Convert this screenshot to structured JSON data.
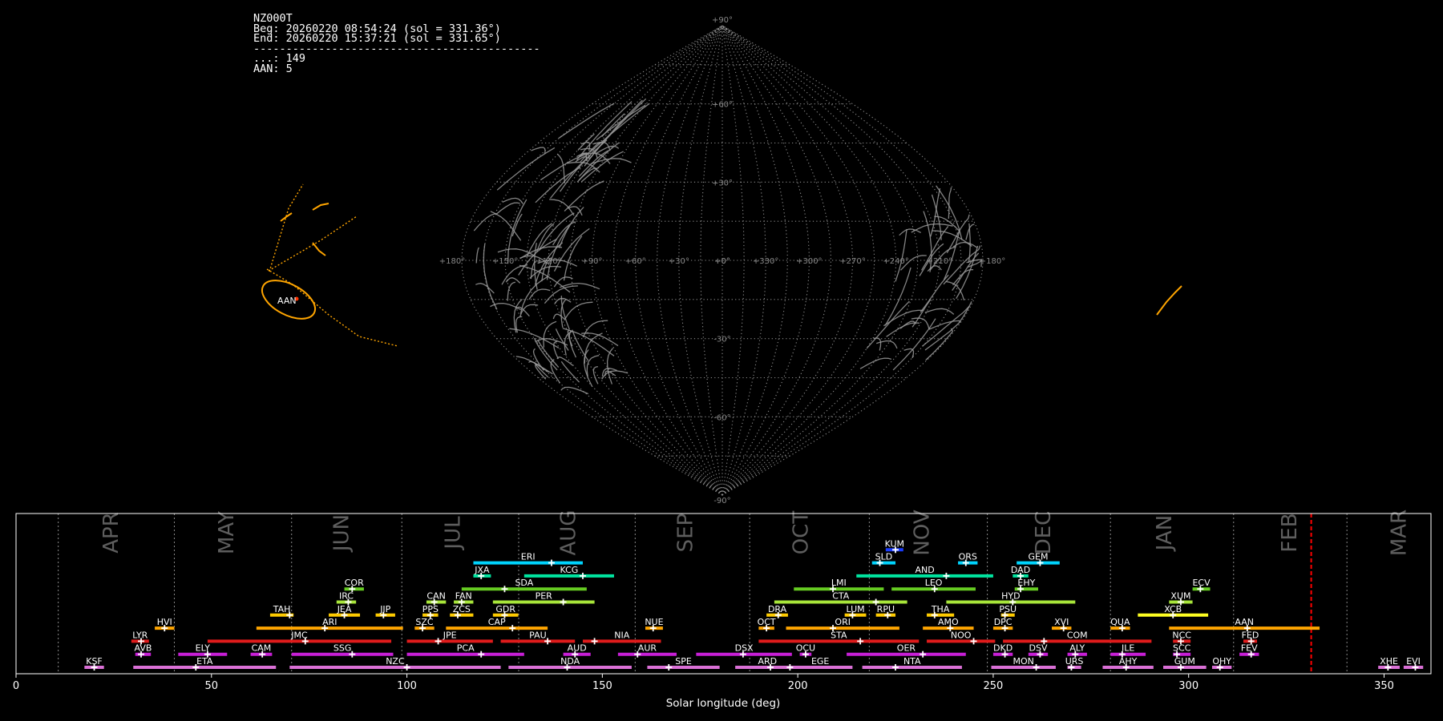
{
  "info": {
    "station": "NZ000T",
    "begin": "Beg: 20260220 08:54:24 (sol = 331.36°)",
    "end": "End: 20260220 15:37:21 (sol = 331.65°)",
    "separator": "--------------------------------------------",
    "sporadic": "...: 149",
    "shower_count": "AAN: 5"
  },
  "sky_map": {
    "projection": "sinusoidal",
    "longitude_labels": [
      "+180°",
      "+150°",
      "+120°",
      "+90°",
      "+60°",
      "+30°",
      "+0°",
      "+330°",
      "+300°",
      "+270°",
      "+240°",
      "+210°",
      "+180°"
    ],
    "latitude_labels": [
      "+90°",
      "+60°",
      "+30°",
      "+0°",
      "-30°",
      "-60°",
      "-90°"
    ],
    "highlighted_shower": "AAN",
    "colors": {
      "grid": "#8c8c8c",
      "sporadic": "#9a9a9a",
      "shower": "#ffa500"
    }
  },
  "chart_data": {
    "type": "timeline",
    "xlabel": "Solar longitude (deg)",
    "xlim": [
      0,
      362
    ],
    "xticks": [
      0,
      50,
      100,
      150,
      200,
      250,
      300,
      350
    ],
    "months": [
      {
        "name": "APR",
        "at": 24.5
      },
      {
        "name": "MAY",
        "at": 54
      },
      {
        "name": "JUN",
        "at": 83.5
      },
      {
        "name": "JUL",
        "at": 112
      },
      {
        "name": "AUG",
        "at": 141.5
      },
      {
        "name": "SEP",
        "at": 171.5
      },
      {
        "name": "OCT",
        "at": 201
      },
      {
        "name": "NOV",
        "at": 232
      },
      {
        "name": "DEC",
        "at": 263
      },
      {
        "name": "JAN",
        "at": 294
      },
      {
        "name": "FEB",
        "at": 326
      },
      {
        "name": "MAR",
        "at": 354
      }
    ],
    "month_boundaries": [
      10.8,
      40.5,
      70.5,
      98.7,
      128.6,
      158.4,
      187.7,
      218.3,
      248.5,
      280.0,
      311.5,
      340.5
    ],
    "current_sol": 331.36,
    "current_color": "#ff0000",
    "showers": [
      {
        "code": "KSF",
        "start": 17.5,
        "end": 22.5,
        "peak": 20,
        "row": 0,
        "color": "#da70d6"
      },
      {
        "code": "ETA",
        "start": 30,
        "end": 66.5,
        "peak": 46,
        "row": 0,
        "color": "#da70d6"
      },
      {
        "code": "NZC",
        "start": 70,
        "end": 124,
        "peak": 100,
        "row": 0,
        "color": "#da70d6"
      },
      {
        "code": "NDA",
        "start": 126,
        "end": 157.5,
        "peak": 141,
        "row": 0,
        "color": "#da70d6"
      },
      {
        "code": "SPE",
        "start": 161.5,
        "end": 180,
        "peak": 167,
        "row": 0,
        "color": "#da70d6"
      },
      {
        "code": "ARD",
        "start": 184,
        "end": 200.5,
        "peak": 193,
        "row": 0,
        "color": "#da70d6"
      },
      {
        "code": "EGE",
        "start": 197.5,
        "end": 214,
        "peak": 198,
        "row": 0,
        "color": "#da70d6"
      },
      {
        "code": "NTA",
        "start": 216.5,
        "end": 242,
        "peak": 225,
        "row": 0,
        "color": "#da70d6"
      },
      {
        "code": "MON",
        "start": 249.5,
        "end": 266,
        "peak": 261,
        "row": 0,
        "color": "#da70d6"
      },
      {
        "code": "URS",
        "start": 269,
        "end": 272.5,
        "peak": 270,
        "row": 0,
        "color": "#da70d6"
      },
      {
        "code": "AHY",
        "start": 278,
        "end": 291,
        "peak": 284,
        "row": 0,
        "color": "#da70d6"
      },
      {
        "code": "GUM",
        "start": 293.5,
        "end": 304.5,
        "peak": 298,
        "row": 0,
        "color": "#da70d6"
      },
      {
        "code": "OHY",
        "start": 306,
        "end": 311,
        "peak": 308,
        "row": 0,
        "color": "#da70d6"
      },
      {
        "code": "XHE",
        "start": 348.5,
        "end": 354,
        "peak": 351,
        "row": 0,
        "color": "#da70d6"
      },
      {
        "code": "EVI",
        "start": 355,
        "end": 360,
        "peak": 358,
        "row": 0,
        "color": "#da70d6"
      },
      {
        "code": "AVB",
        "start": 30.5,
        "end": 34.5,
        "peak": 32,
        "row": 1,
        "color": "#c71fd6"
      },
      {
        "code": "ELY",
        "start": 41.5,
        "end": 54,
        "peak": 49,
        "row": 1,
        "color": "#c71fd6"
      },
      {
        "code": "CAM",
        "start": 60,
        "end": 65.5,
        "peak": 63,
        "row": 1,
        "color": "#c71fd6"
      },
      {
        "code": "SSG",
        "start": 70.5,
        "end": 96.5,
        "peak": 86,
        "row": 1,
        "color": "#c71fd6"
      },
      {
        "code": "PCA",
        "start": 100,
        "end": 130,
        "peak": 119,
        "row": 1,
        "color": "#c71fd6"
      },
      {
        "code": "AUD",
        "start": 140,
        "end": 147,
        "peak": 143,
        "row": 1,
        "color": "#c71fd6"
      },
      {
        "code": "AUR",
        "start": 154,
        "end": 169,
        "peak": 159,
        "row": 1,
        "color": "#c71fd6"
      },
      {
        "code": "DSX",
        "start": 174,
        "end": 198.5,
        "peak": 186,
        "row": 1,
        "color": "#c71fd6"
      },
      {
        "code": "OCU",
        "start": 200.5,
        "end": 203.5,
        "peak": 202,
        "row": 1,
        "color": "#c71fd6"
      },
      {
        "code": "OER",
        "start": 212.5,
        "end": 243,
        "peak": 232,
        "row": 1,
        "color": "#c71fd6"
      },
      {
        "code": "DKD",
        "start": 250,
        "end": 255,
        "peak": 253,
        "row": 1,
        "color": "#c71fd6"
      },
      {
        "code": "DSV",
        "start": 259,
        "end": 264,
        "peak": 262,
        "row": 1,
        "color": "#c71fd6"
      },
      {
        "code": "ALY",
        "start": 269,
        "end": 274,
        "peak": 271,
        "row": 1,
        "color": "#c71fd6"
      },
      {
        "code": "ILE",
        "start": 280,
        "end": 289,
        "peak": 283,
        "row": 1,
        "color": "#c71fd6"
      },
      {
        "code": "SCC",
        "start": 296,
        "end": 300.5,
        "peak": 297,
        "row": 1,
        "color": "#c71fd6"
      },
      {
        "code": "FEV",
        "start": 313,
        "end": 318,
        "peak": 316,
        "row": 1,
        "color": "#c71fd6"
      },
      {
        "code": "LYR",
        "start": 29.5,
        "end": 34,
        "peak": 32,
        "row": 2,
        "color": "#e01b1b"
      },
      {
        "code": "JMC",
        "start": 49,
        "end": 96,
        "peak": 74,
        "row": 2,
        "color": "#e01b1b"
      },
      {
        "code": "JPE",
        "start": 100,
        "end": 122,
        "peak": 108,
        "row": 2,
        "color": "#e01b1b"
      },
      {
        "code": "PAU",
        "start": 124,
        "end": 143,
        "peak": 136,
        "row": 2,
        "color": "#e01b1b"
      },
      {
        "code": "NIA",
        "start": 145,
        "end": 165,
        "peak": 148,
        "row": 2,
        "color": "#e01b1b"
      },
      {
        "code": "STA",
        "start": 190,
        "end": 231,
        "peak": 216,
        "row": 2,
        "color": "#e01b1b"
      },
      {
        "code": "NOO",
        "start": 233,
        "end": 250.5,
        "peak": 245,
        "row": 2,
        "color": "#e01b1b"
      },
      {
        "code": "COM",
        "start": 252.5,
        "end": 290.5,
        "peak": 263,
        "row": 2,
        "color": "#e01b1b"
      },
      {
        "code": "NCC",
        "start": 296,
        "end": 300.5,
        "peak": 298,
        "row": 2,
        "color": "#e01b1b"
      },
      {
        "code": "FED",
        "start": 314,
        "end": 317.5,
        "peak": 316,
        "row": 2,
        "color": "#e01b1b"
      },
      {
        "code": "HVI",
        "start": 35.5,
        "end": 40.5,
        "peak": 38,
        "row": 3,
        "color": "#ffa500"
      },
      {
        "code": "ARI",
        "start": 61.5,
        "end": 99,
        "peak": 79,
        "row": 3,
        "color": "#ffa500"
      },
      {
        "code": "SZC",
        "start": 102,
        "end": 107,
        "peak": 104,
        "row": 3,
        "color": "#ffa500"
      },
      {
        "code": "CAP",
        "start": 110,
        "end": 136,
        "peak": 127,
        "row": 3,
        "color": "#ffa500"
      },
      {
        "code": "NUE",
        "start": 161,
        "end": 165.5,
        "peak": 163,
        "row": 3,
        "color": "#ffa500"
      },
      {
        "code": "OCT",
        "start": 190,
        "end": 194,
        "peak": 192,
        "row": 3,
        "color": "#ffa500"
      },
      {
        "code": "ORI",
        "start": 197,
        "end": 226,
        "peak": 209,
        "row": 3,
        "color": "#ffa500"
      },
      {
        "code": "AMO",
        "start": 232,
        "end": 245,
        "peak": 239,
        "row": 3,
        "color": "#ffa500"
      },
      {
        "code": "DPC",
        "start": 250,
        "end": 255,
        "peak": 253,
        "row": 3,
        "color": "#ffa500"
      },
      {
        "code": "XVI",
        "start": 265,
        "end": 270,
        "peak": 268,
        "row": 3,
        "color": "#ffa500"
      },
      {
        "code": "QUA",
        "start": 280,
        "end": 285,
        "peak": 283,
        "row": 3,
        "color": "#ffa500"
      },
      {
        "code": "AAN",
        "start": 295,
        "end": 333.5,
        "peak": 315,
        "row": 3,
        "color": "#ffa500"
      },
      {
        "code": "TAH",
        "start": 65,
        "end": 71,
        "peak": 70,
        "row": 4,
        "color": "#ffcc00"
      },
      {
        "code": "JEA",
        "start": 80,
        "end": 88,
        "peak": 84,
        "row": 4,
        "color": "#ffcc00"
      },
      {
        "code": "JIP",
        "start": 92,
        "end": 97,
        "peak": 94,
        "row": 4,
        "color": "#ffcc00"
      },
      {
        "code": "PPS",
        "start": 104,
        "end": 108,
        "peak": 106,
        "row": 4,
        "color": "#ffcc00"
      },
      {
        "code": "ZCS",
        "start": 111,
        "end": 117,
        "peak": 113,
        "row": 4,
        "color": "#ffcc00"
      },
      {
        "code": "GDR",
        "start": 122,
        "end": 128.5,
        "peak": 125,
        "row": 4,
        "color": "#ffcc00"
      },
      {
        "code": "DRA",
        "start": 192,
        "end": 197.5,
        "peak": 195,
        "row": 4,
        "color": "#ffcc00"
      },
      {
        "code": "LUM",
        "start": 212,
        "end": 217.5,
        "peak": 214,
        "row": 4,
        "color": "#ffcc00"
      },
      {
        "code": "RPU",
        "start": 220,
        "end": 225,
        "peak": 223,
        "row": 4,
        "color": "#ffcc00"
      },
      {
        "code": "THA",
        "start": 233,
        "end": 240,
        "peak": 235,
        "row": 4,
        "color": "#ffcc00"
      },
      {
        "code": "PSU",
        "start": 252,
        "end": 255.5,
        "peak": 253,
        "row": 4,
        "color": "#ffcc00"
      },
      {
        "code": "XCB",
        "start": 287,
        "end": 305,
        "peak": 296,
        "row": 4,
        "color": "#ffff22"
      },
      {
        "code": "IRC",
        "start": 82,
        "end": 87,
        "peak": 85,
        "row": 5,
        "color": "#a8e63a"
      },
      {
        "code": "CAN",
        "start": 105,
        "end": 110,
        "peak": 107,
        "row": 5,
        "color": "#a8e63a"
      },
      {
        "code": "FAN",
        "start": 112,
        "end": 117,
        "peak": 114,
        "row": 5,
        "color": "#a8e63a"
      },
      {
        "code": "PER",
        "start": 122,
        "end": 148,
        "peak": 140,
        "row": 5,
        "color": "#a8e63a"
      },
      {
        "code": "CTA",
        "start": 194,
        "end": 228,
        "peak": 220,
        "row": 5,
        "color": "#a8e63a"
      },
      {
        "code": "HYD",
        "start": 238,
        "end": 271,
        "peak": 255,
        "row": 5,
        "color": "#a8e63a"
      },
      {
        "code": "XUM",
        "start": 295,
        "end": 301,
        "peak": 298,
        "row": 5,
        "color": "#a8e63a"
      },
      {
        "code": "COR",
        "start": 84,
        "end": 89,
        "peak": 86,
        "row": 6,
        "color": "#66cc22"
      },
      {
        "code": "SDA",
        "start": 114,
        "end": 146,
        "peak": 125,
        "row": 6,
        "color": "#66cc22"
      },
      {
        "code": "LMI",
        "start": 199,
        "end": 222,
        "peak": 209,
        "row": 6,
        "color": "#66cc22"
      },
      {
        "code": "LEO",
        "start": 224,
        "end": 245.5,
        "peak": 235,
        "row": 6,
        "color": "#66cc22"
      },
      {
        "code": "EHY",
        "start": 255.5,
        "end": 261.5,
        "peak": 257,
        "row": 6,
        "color": "#66cc22"
      },
      {
        "code": "ECV",
        "start": 301,
        "end": 305.5,
        "peak": 303,
        "row": 6,
        "color": "#66cc22"
      },
      {
        "code": "JXA",
        "start": 117,
        "end": 121.5,
        "peak": 119,
        "row": 7,
        "color": "#00e5a0"
      },
      {
        "code": "KCG",
        "start": 130,
        "end": 153,
        "peak": 145,
        "row": 7,
        "color": "#00e5a0"
      },
      {
        "code": "AND",
        "start": 215,
        "end": 250,
        "peak": 238,
        "row": 7,
        "color": "#00e5a0"
      },
      {
        "code": "DAD",
        "start": 255,
        "end": 259,
        "peak": 257,
        "row": 7,
        "color": "#00e5a0"
      },
      {
        "code": "ERI",
        "start": 117,
        "end": 145,
        "peak": 137,
        "row": 8,
        "color": "#00d5ff"
      },
      {
        "code": "SLD",
        "start": 219,
        "end": 225,
        "peak": 221,
        "row": 8,
        "color": "#00d5ff"
      },
      {
        "code": "ORS",
        "start": 241,
        "end": 246,
        "peak": 243,
        "row": 8,
        "color": "#00d5ff"
      },
      {
        "code": "GEM",
        "start": 256,
        "end": 267,
        "peak": 262,
        "row": 8,
        "color": "#00d5ff"
      },
      {
        "code": "KUM",
        "start": 222.5,
        "end": 227,
        "peak": 225,
        "row": 9,
        "color": "#1a3cff"
      }
    ]
  }
}
